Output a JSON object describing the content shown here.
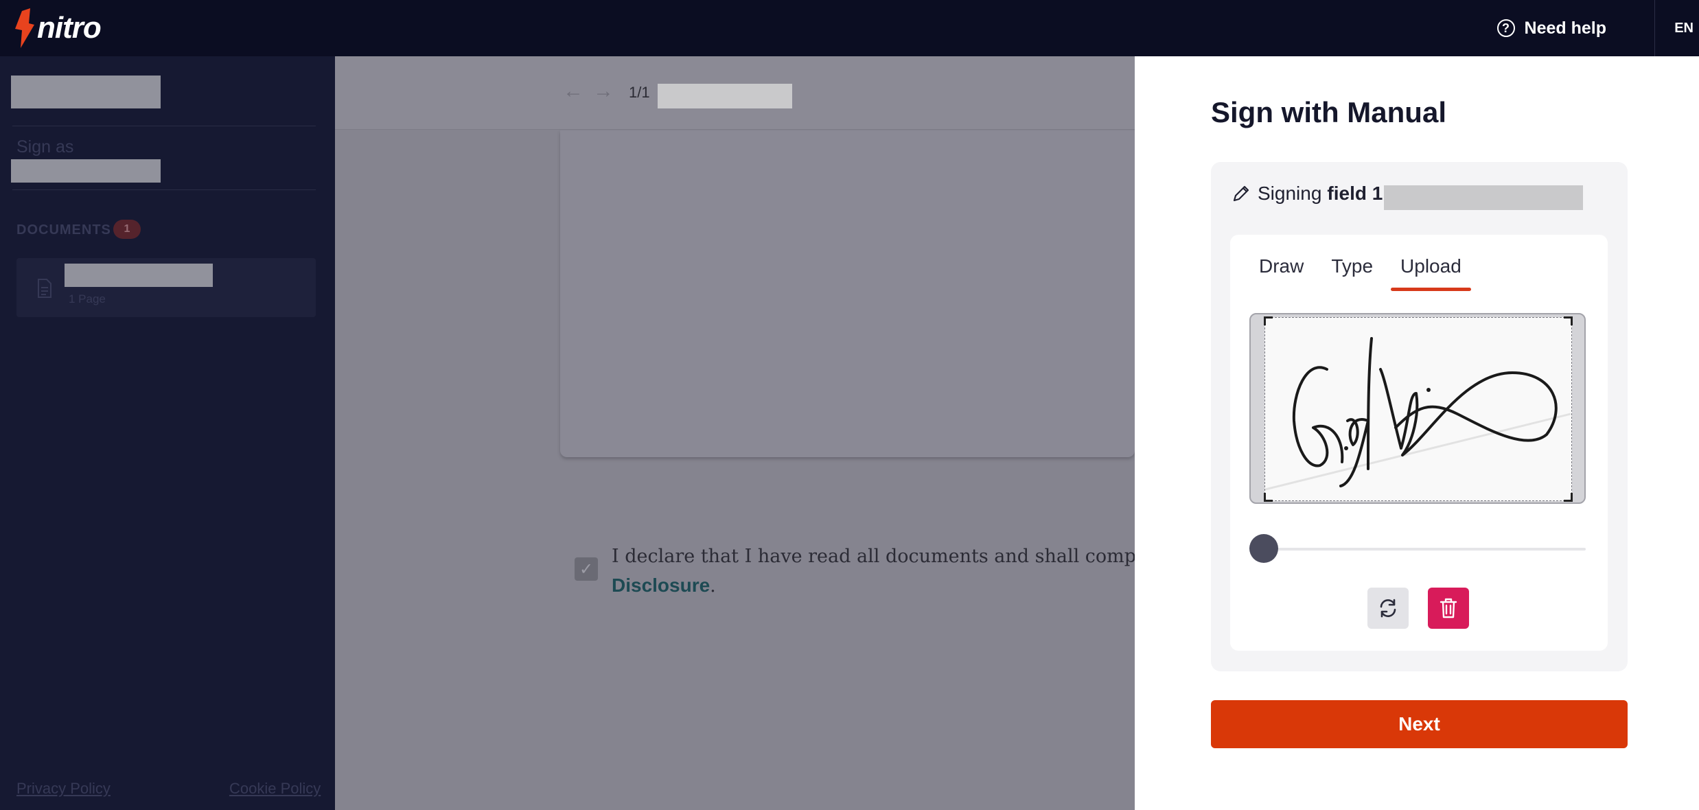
{
  "header": {
    "brand_name": "nitro",
    "help_label": "Need help",
    "language": "EN",
    "icons": [
      "nitro-logo-icon",
      "help-circle-icon"
    ]
  },
  "sidebar": {
    "sign_as_label": "Sign as",
    "documents_label": "DOCUMENTS",
    "documents_count": "1",
    "document": {
      "pages_label": "1 Page",
      "icon": "document-icon"
    },
    "privacy_label": "Privacy Policy",
    "cookie_label": "Cookie Policy"
  },
  "viewer": {
    "page_indicator": "1/1",
    "declaration_text": "I declare that I have read all documents and shall comply wit",
    "disclosure_label": "Disclosure",
    "disclosure_suffix": ".",
    "icons": [
      "arrow-left-icon",
      "arrow-right-icon",
      "checkmark-icon"
    ]
  },
  "panel": {
    "title": "Sign with Manual",
    "signing_prefix": "Signing",
    "signing_field": "field 1",
    "tabs": [
      {
        "label": "Draw",
        "active": false
      },
      {
        "label": "Type",
        "active": false
      },
      {
        "label": "Upload",
        "active": true
      }
    ],
    "size_slider_fraction": 0.0,
    "next_label": "Next",
    "colors": {
      "accent": "#d93808",
      "delete": "#d81b5a",
      "header": "#0b0d22"
    }
  }
}
